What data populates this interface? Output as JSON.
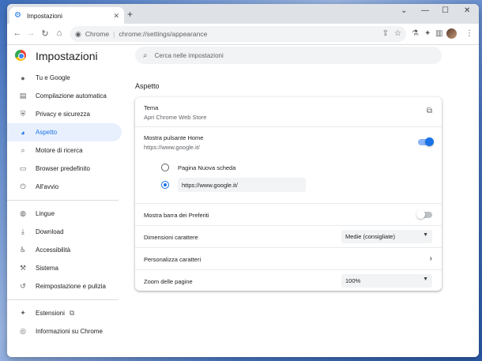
{
  "browser": {
    "tab_title": "Impostazioni",
    "tab_close": "✕",
    "new_tab": "+",
    "omnibox_site": "Chrome",
    "omnibox_url": "chrome://settings/appearance",
    "window_controls": [
      "⌄",
      "—",
      "☐",
      "✕"
    ]
  },
  "header": {
    "title": "Impostazioni",
    "search_placeholder": "Cerca nelle impostazioni"
  },
  "sidebar": {
    "active_index": 3,
    "items": [
      {
        "label": "Tu e Google",
        "icon": "person-icon"
      },
      {
        "label": "Compilazione automatica",
        "icon": "clipboard-icon"
      },
      {
        "label": "Privacy e sicurezza",
        "icon": "shield-icon"
      },
      {
        "label": "Aspetto",
        "icon": "palette-icon"
      },
      {
        "label": "Motore di ricerca",
        "icon": "search-icon"
      },
      {
        "label": "Browser predefinito",
        "icon": "browser-icon"
      },
      {
        "label": "All'avvio",
        "icon": "power-icon"
      },
      {
        "label": "Lingue",
        "icon": "globe-icon"
      },
      {
        "label": "Download",
        "icon": "download-icon"
      },
      {
        "label": "Accessibilità",
        "icon": "accessibility-icon"
      },
      {
        "label": "Sistema",
        "icon": "wrench-icon"
      },
      {
        "label": "Reimpostazione e pulizia",
        "icon": "history-icon"
      },
      {
        "label": "Estensioni",
        "icon": "puzzle-icon"
      },
      {
        "label": "Informazioni su Chrome",
        "icon": "chrome-icon"
      }
    ]
  },
  "appearance": {
    "section_title": "Aspetto",
    "theme_title": "Tema",
    "theme_sub": "Apri Chrome Web Store",
    "home_title": "Mostra pulsante Home",
    "home_sub": "https://www.google.it/",
    "home_enabled": true,
    "radio_new_tab": "Pagina Nuova scheda",
    "radio_url_value": "https://www.google.it/",
    "bookmarks_title": "Mostra barra dei Preferiti",
    "bookmarks_enabled": false,
    "font_size_title": "Dimensioni carattere",
    "font_size_value": "Medie (consigliate)",
    "customize_fonts_title": "Personalizza caratteri",
    "zoom_title": "Zoom delle pagine",
    "zoom_value": "100%"
  },
  "colors": {
    "accent": "#1a73e8",
    "active_bg": "#e8f0fe"
  }
}
